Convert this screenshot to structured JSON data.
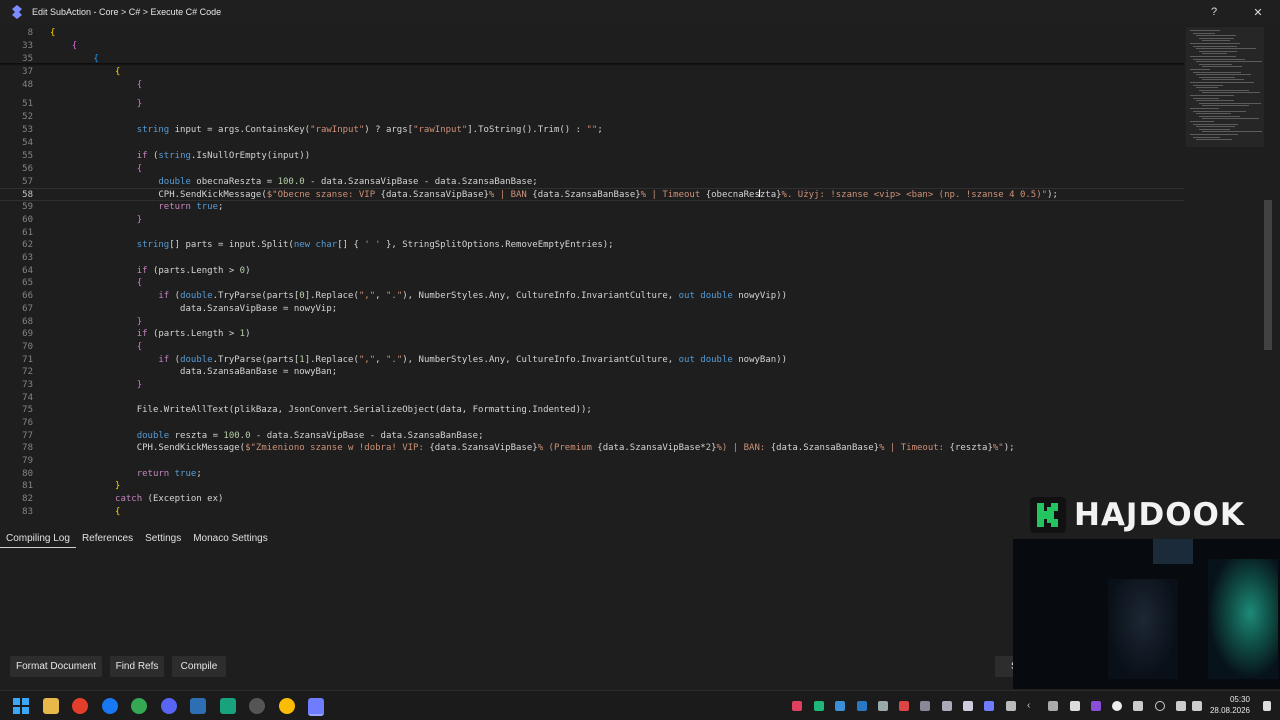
{
  "window": {
    "title": "Edit SubAction - Core > C# > Execute C# Code",
    "help_label": "?",
    "close_label": "✕"
  },
  "editor": {
    "lines": [
      {
        "n": "8",
        "html": "<span class=\"br1\">{</span>"
      },
      {
        "n": "33",
        "html": "    <span class=\"br2\">{</span>"
      },
      {
        "n": "35",
        "html": "        <span class=\"br3\">{</span>"
      },
      {
        "n": "37",
        "html": "            <span class=\"br1\">{</span>"
      },
      {
        "n": "48",
        "html": "                <span class=\"br2\">{</span>"
      },
      {
        "n": "51",
        "html": "                <span class=\"br2\">}</span>"
      },
      {
        "n": "52",
        "html": ""
      },
      {
        "n": "53",
        "html": "                <span class=\"kw\">string</span> input = args.ContainsKey(<span class=\"str\">\"rawInput\"</span>) ? args[<span class=\"str\">\"rawInput\"</span>].ToString().Trim() : <span class=\"str\">\"\"</span>;"
      },
      {
        "n": "54",
        "html": ""
      },
      {
        "n": "55",
        "html": "                <span class=\"kw2\">if</span> (<span class=\"kw\">string</span>.IsNullOrEmpty(input))"
      },
      {
        "n": "56",
        "html": "                <span class=\"br2\">{</span>"
      },
      {
        "n": "57",
        "html": "                    <span class=\"kw\">double</span> obecnaReszta = <span class=\"num\">100.0</span> - data.SzansaVipBase - data.SzansaBanBase;"
      },
      {
        "n": "58",
        "html": "                    CPH.SendKickMessage(<span class=\"str\">$\"Obecne szanse: VIP </span>{data.SzansaVipBase}<span class=\"str\">% | BAN </span>{data.SzansaBanBase}<span class=\"str\">% | Timeout </span>{obecnaReszta}<span class=\"str\">%. Użyj: !szanse &lt;vip&gt; &lt;ban&gt; (np. !szanse 4 0.5)\"</span>);",
        "active": true
      },
      {
        "n": "59",
        "html": "                    <span class=\"kw2\">return</span> <span class=\"kw\">true</span>;"
      },
      {
        "n": "60",
        "html": "                <span class=\"br2\">}</span>"
      },
      {
        "n": "61",
        "html": ""
      },
      {
        "n": "62",
        "html": "                <span class=\"kw\">string</span>[] parts = input.Split(<span class=\"kw\">new</span> <span class=\"kw\">char</span>[] { <span class=\"str\">' '</span> }, StringSplitOptions.RemoveEmptyEntries);"
      },
      {
        "n": "63",
        "html": ""
      },
      {
        "n": "64",
        "html": "                <span class=\"kw2\">if</span> (parts.Length &gt; <span class=\"num\">0</span>)"
      },
      {
        "n": "65",
        "html": "                <span class=\"br2\">{</span>"
      },
      {
        "n": "66",
        "html": "                    <span class=\"kw2\">if</span> (<span class=\"kw\">double</span>.TryParse(parts[<span class=\"num\">0</span>].Replace(<span class=\"str\">\",\"</span>, <span class=\"str\">\".\"</span>), NumberStyles.Any, CultureInfo.InvariantCulture, <span class=\"kw\">out</span> <span class=\"kw\">double</span> nowyVip))"
      },
      {
        "n": "67",
        "html": "                        data.SzansaVipBase = nowyVip;"
      },
      {
        "n": "68",
        "html": "                <span class=\"br2\">}</span>"
      },
      {
        "n": "69",
        "html": "                <span class=\"kw2\">if</span> (parts.Length &gt; <span class=\"num\">1</span>)"
      },
      {
        "n": "70",
        "html": "                <span class=\"br2\">{</span>"
      },
      {
        "n": "71",
        "html": "                    <span class=\"kw2\">if</span> (<span class=\"kw\">double</span>.TryParse(parts[<span class=\"num\">1</span>].Replace(<span class=\"str\">\",\"</span>, <span class=\"str\">\".\"</span>), NumberStyles.Any, CultureInfo.InvariantCulture, <span class=\"kw\">out</span> <span class=\"kw\">double</span> nowyBan))"
      },
      {
        "n": "72",
        "html": "                        data.SzansaBanBase = nowyBan;"
      },
      {
        "n": "73",
        "html": "                <span class=\"br2\">}</span>"
      },
      {
        "n": "74",
        "html": ""
      },
      {
        "n": "75",
        "html": "                File.WriteAllText(plikBaza, JsonConvert.SerializeObject(data, Formatting.Indented));"
      },
      {
        "n": "76",
        "html": ""
      },
      {
        "n": "77",
        "html": "                <span class=\"kw\">double</span> reszta = <span class=\"num\">100.0</span> - data.SzansaVipBase - data.SzansaBanBase;"
      },
      {
        "n": "78",
        "html": "                CPH.SendKickMessage(<span class=\"str\">$\"Zmieniono szanse w !dobra! VIP: </span>{data.SzansaVipBase}<span class=\"str\">% (Premium </span>{data.SzansaVipBase*<span class=\"num\">2</span>}<span class=\"str\">%) | BAN: </span>{data.SzansaBanBase}<span class=\"str\">% | Timeout: </span>{reszta}<span class=\"str\">%\"</span>);"
      },
      {
        "n": "79",
        "html": ""
      },
      {
        "n": "80",
        "html": "                <span class=\"kw2\">return</span> <span class=\"kw\">true</span>;"
      },
      {
        "n": "81",
        "html": "            <span class=\"br1\">}</span>"
      },
      {
        "n": "82",
        "html": "            <span class=\"kw2\">catch</span> (Exception ex)"
      },
      {
        "n": "83",
        "html": "            <span class=\"br1\">{</span>"
      }
    ]
  },
  "tabs": [
    "Compiling Log",
    "References",
    "Settings",
    "Monaco Settings"
  ],
  "buttons": {
    "format": "Format Document",
    "find_refs": "Find Refs",
    "compile": "Compile",
    "cut": "S"
  },
  "brand": {
    "text": "HAJDOOK"
  },
  "clock": {
    "time": "05:30",
    "date": "28.08.2026"
  },
  "colors": {
    "editor_bg": "#1e1e1e",
    "keyword": "#569cd6",
    "control": "#c586c0",
    "string": "#ce9178",
    "number": "#b5cea8",
    "brand_green": "#22c55e"
  }
}
